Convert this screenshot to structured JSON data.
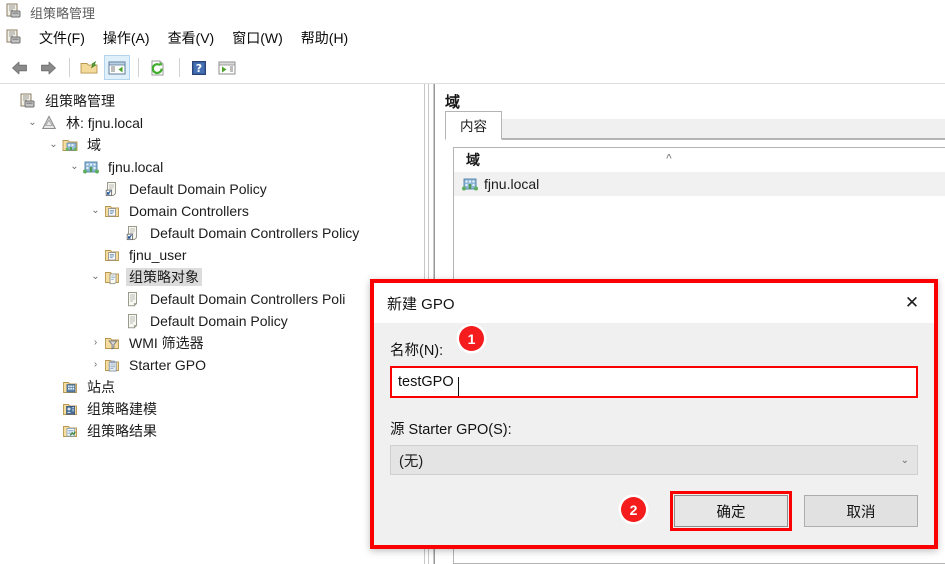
{
  "window": {
    "title": "组策略管理",
    "icon": "gpmc-console-icon"
  },
  "menubar": {
    "icon": "gpmc-console-icon",
    "items": [
      {
        "label": "文件(F)",
        "name": "menu-file"
      },
      {
        "label": "操作(A)",
        "name": "menu-action"
      },
      {
        "label": "查看(V)",
        "name": "menu-view"
      },
      {
        "label": "窗口(W)",
        "name": "menu-window"
      },
      {
        "label": "帮助(H)",
        "name": "menu-help"
      }
    ]
  },
  "toolbar": {
    "buttons": [
      {
        "name": "back-arrow-icon",
        "icon": "back-arrow-icon",
        "active": false
      },
      {
        "name": "forward-arrow-icon",
        "icon": "forward-arrow-icon",
        "active": false
      },
      {
        "name": "up-folder-icon",
        "icon": "up-folder-icon",
        "active": false
      },
      {
        "name": "show-hide-tree-icon",
        "icon": "show-hide-tree-icon",
        "active": true
      },
      {
        "name": "refresh-icon",
        "icon": "refresh-icon",
        "active": false
      },
      {
        "name": "help-icon",
        "icon": "help-icon",
        "active": false
      },
      {
        "name": "show-action-pane-icon",
        "icon": "show-action-pane-icon",
        "active": false
      }
    ]
  },
  "tree": {
    "nodes": [
      {
        "label": "组策略管理",
        "indent": 0,
        "twisty": "",
        "icon": "gpmc-console-icon",
        "selected": false
      },
      {
        "label": "林: fjnu.local",
        "indent": 1,
        "twisty": "⌄",
        "icon": "forest-icon",
        "selected": false
      },
      {
        "label": "域",
        "indent": 2,
        "twisty": "⌄",
        "icon": "domains-folder-icon",
        "selected": false
      },
      {
        "label": "fjnu.local",
        "indent": 3,
        "twisty": "⌄",
        "icon": "domain-icon",
        "selected": false
      },
      {
        "label": "Default Domain Policy",
        "indent": 4,
        "twisty": "",
        "icon": "gpo-link-icon",
        "selected": false
      },
      {
        "label": "Domain Controllers",
        "indent": 4,
        "twisty": "⌄",
        "icon": "ou-icon",
        "selected": false
      },
      {
        "label": "Default Domain Controllers Policy",
        "indent": 5,
        "twisty": "",
        "icon": "gpo-link-icon",
        "selected": false
      },
      {
        "label": "fjnu_user",
        "indent": 4,
        "twisty": "",
        "icon": "ou-icon",
        "selected": false
      },
      {
        "label": "组策略对象",
        "indent": 4,
        "twisty": "⌄",
        "icon": "gpo-container-icon",
        "selected": true
      },
      {
        "label": "Default Domain Controllers Poli",
        "indent": 5,
        "twisty": "",
        "icon": "gpo-icon",
        "selected": false
      },
      {
        "label": "Default Domain Policy",
        "indent": 5,
        "twisty": "",
        "icon": "gpo-icon",
        "selected": false
      },
      {
        "label": "WMI 筛选器",
        "indent": 4,
        "twisty": "›",
        "icon": "wmi-filter-icon",
        "selected": false
      },
      {
        "label": "Starter GPO",
        "indent": 4,
        "twisty": "›",
        "icon": "starter-gpo-icon",
        "selected": false
      },
      {
        "label": "站点",
        "indent": 2,
        "twisty": "",
        "icon": "sites-icon",
        "selected": false
      },
      {
        "label": "组策略建模",
        "indent": 2,
        "twisty": "",
        "icon": "modeling-icon",
        "selected": false
      },
      {
        "label": "组策略结果",
        "indent": 2,
        "twisty": "",
        "icon": "results-icon",
        "selected": false
      }
    ]
  },
  "right_panel": {
    "header": "域",
    "tabs": [
      {
        "label": "内容",
        "active": true
      }
    ],
    "list": {
      "column_header": "域",
      "sort_indicator": "^",
      "rows": [
        {
          "label": "fjnu.local",
          "icon": "domain-icon",
          "selected": true
        }
      ]
    }
  },
  "dialog": {
    "title": "新建 GPO",
    "close_label": "✕",
    "name_label": "名称(N):",
    "name_value": "testGPO",
    "name_placeholder": "",
    "starter_label": "源 Starter GPO(S):",
    "starter_value": "(无)",
    "starter_chevron": "⌄",
    "ok_label": "确定",
    "cancel_label": "取消"
  },
  "annotations": {
    "badges": [
      {
        "number": "1",
        "target": "name-input"
      },
      {
        "number": "2",
        "target": "ok-button"
      }
    ],
    "highlight_color": "#fb0000"
  }
}
